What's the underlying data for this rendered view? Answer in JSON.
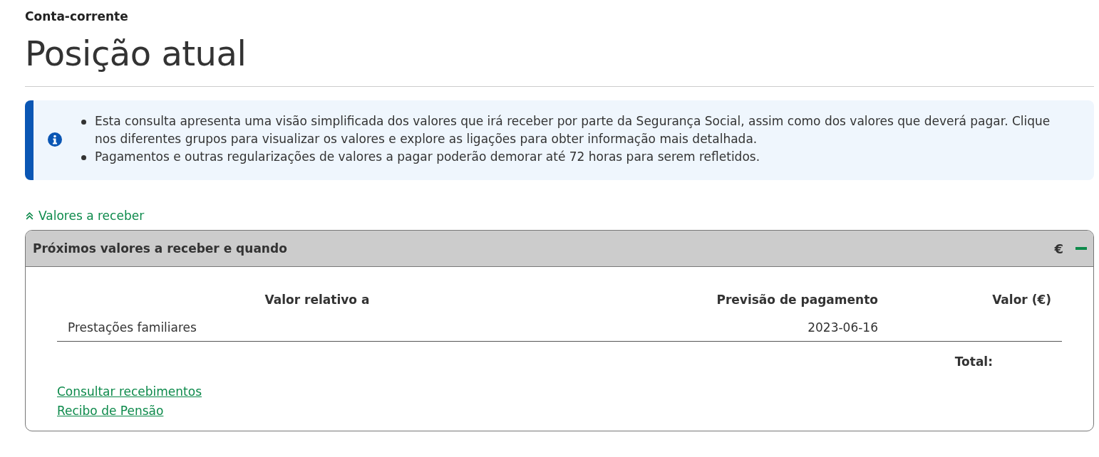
{
  "breadcrumb": "Conta-corrente",
  "title": "Posição atual",
  "info": {
    "items": [
      "Esta consulta apresenta uma visão simplificada dos valores que irá receber por parte da Segurança Social, assim como dos valores que deverá pagar. Clique nos diferentes grupos para visualizar os valores e explore as ligações para obter informação mais detalhada.",
      "Pagamentos e outras regularizações de valores a pagar poderão demorar até 72 horas para serem refletidos."
    ]
  },
  "section_toggle": {
    "label": "Valores a receber",
    "expanded": true
  },
  "panel": {
    "title": "Próximos valores a receber e quando",
    "currency": "€",
    "expanded": true,
    "columns": [
      "Valor relativo a",
      "Previsão de pagamento",
      "Valor (€)"
    ],
    "rows": [
      {
        "description": "Prestações familiares",
        "date": "2023-06-16"
      }
    ],
    "total_label": "Total:",
    "links": [
      "Consultar recebimentos",
      "Recibo de Pensão"
    ]
  }
}
